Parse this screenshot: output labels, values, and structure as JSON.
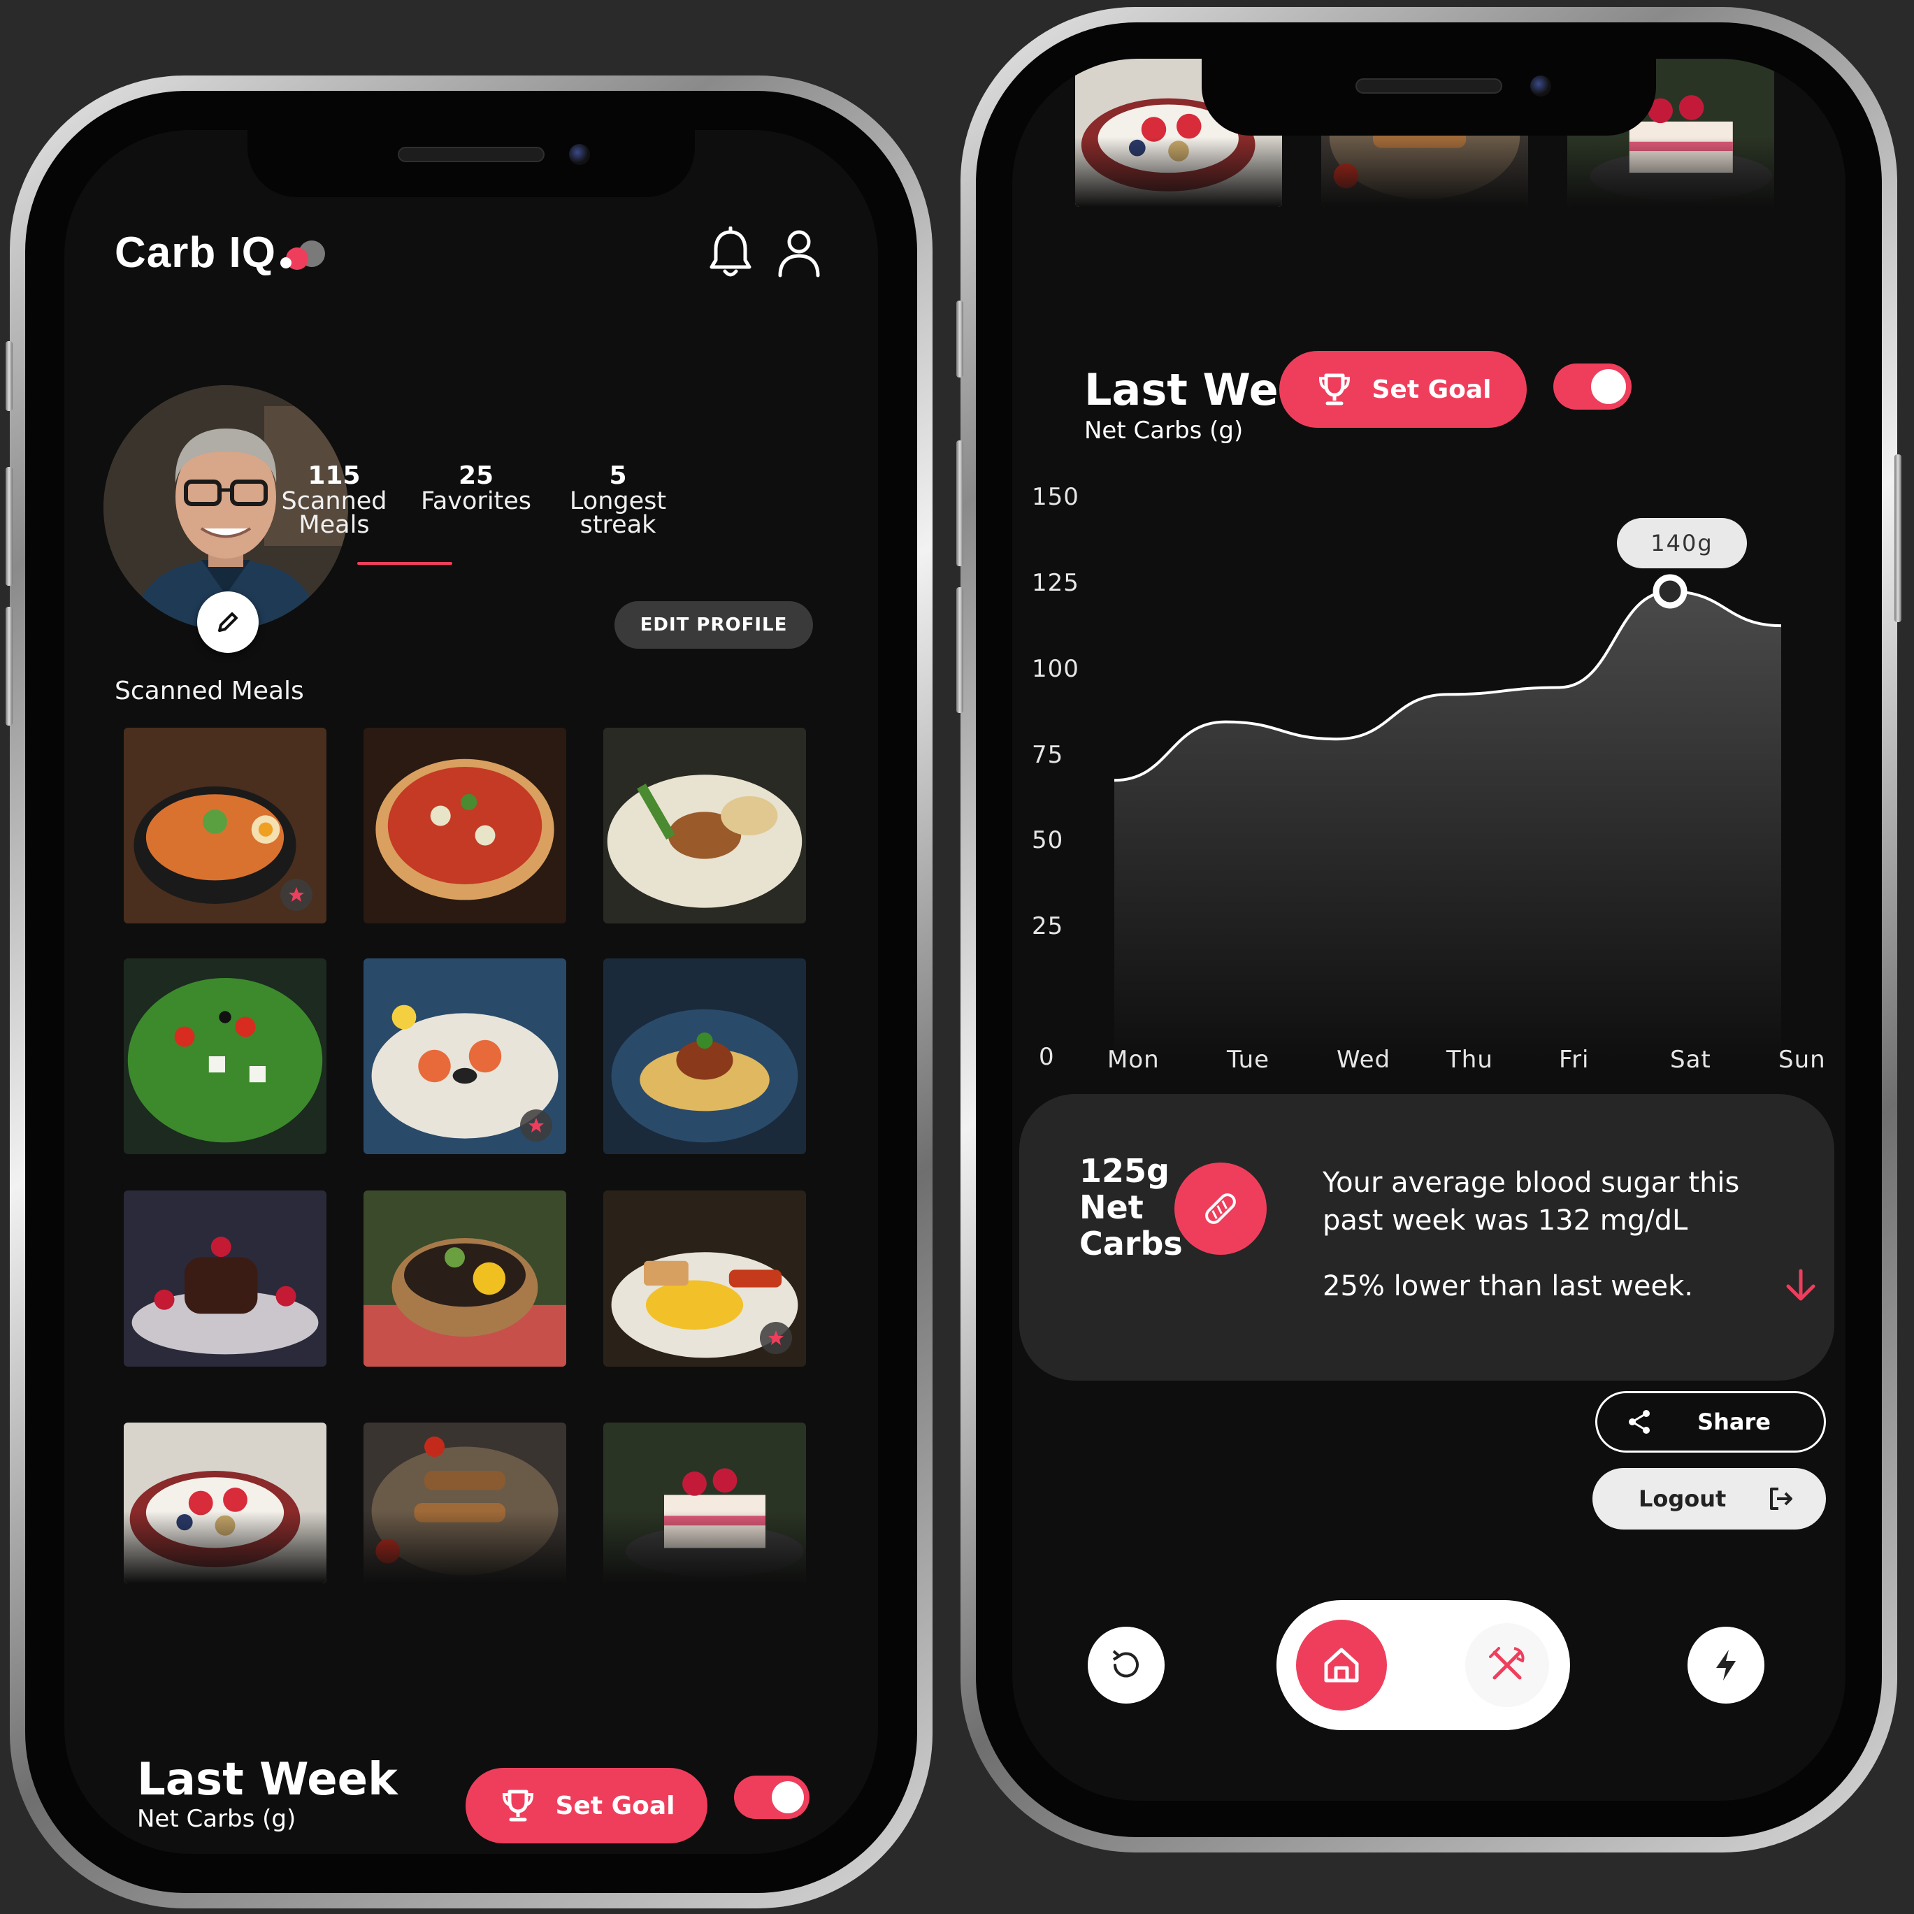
{
  "app": {
    "name": "Carb IQ"
  },
  "profile": {
    "stats": [
      {
        "value": "115",
        "label_line1": "Scanned",
        "label_line2": "Meals"
      },
      {
        "value": "25",
        "label_line1": "Favorites",
        "label_line2": ""
      },
      {
        "value": "5",
        "label_line1": "Longest",
        "label_line2": "streak"
      }
    ],
    "edit_button": "EDIT PROFILE"
  },
  "scanned_meals": {
    "title": "Scanned Meals",
    "items": [
      {
        "icon": "ramen-bowl",
        "favorite": true
      },
      {
        "icon": "pizza",
        "favorite": false
      },
      {
        "icon": "chicken-asparagus",
        "favorite": false
      },
      {
        "icon": "greek-salad",
        "favorite": false
      },
      {
        "icon": "seafood-plate",
        "favorite": true
      },
      {
        "icon": "pasta-patty",
        "favorite": false
      },
      {
        "icon": "lava-cake",
        "favorite": false
      },
      {
        "icon": "grain-bowl",
        "favorite": false
      },
      {
        "icon": "breakfast-plate",
        "favorite": true
      },
      {
        "icon": "fruit-yogurt-bowl",
        "favorite": false
      },
      {
        "icon": "grilled-platter",
        "favorite": false
      },
      {
        "icon": "strawberry-cake",
        "favorite": false
      }
    ]
  },
  "weekly": {
    "title": "Last Week",
    "subtitle": "Net Carbs (g)",
    "set_goal_label": "Set Goal",
    "toggle_on": true
  },
  "chart_data": {
    "type": "area",
    "categories": [
      "Mon",
      "Tue",
      "Wed",
      "Thu",
      "Fri",
      "Sat",
      "Sun"
    ],
    "values": [
      83,
      100,
      95,
      108,
      110,
      138,
      128
    ],
    "ylim": [
      0,
      150
    ],
    "yticks": [
      0,
      25,
      50,
      75,
      100,
      125,
      150
    ],
    "grid": false,
    "peak_label": "140g",
    "peak_index": 5
  },
  "summary": {
    "net_carbs_value": "125g",
    "net_carbs_label1": "Net",
    "net_carbs_label2": "Carbs",
    "message": "Your average blood sugar this past week was 132 mg/dL",
    "comparison": "25% lower than last week."
  },
  "actions": {
    "share": "Share",
    "logout": "Logout"
  },
  "colors": {
    "accent": "#ef3e5c",
    "background": "#0e0e0e",
    "card": "#262626"
  }
}
